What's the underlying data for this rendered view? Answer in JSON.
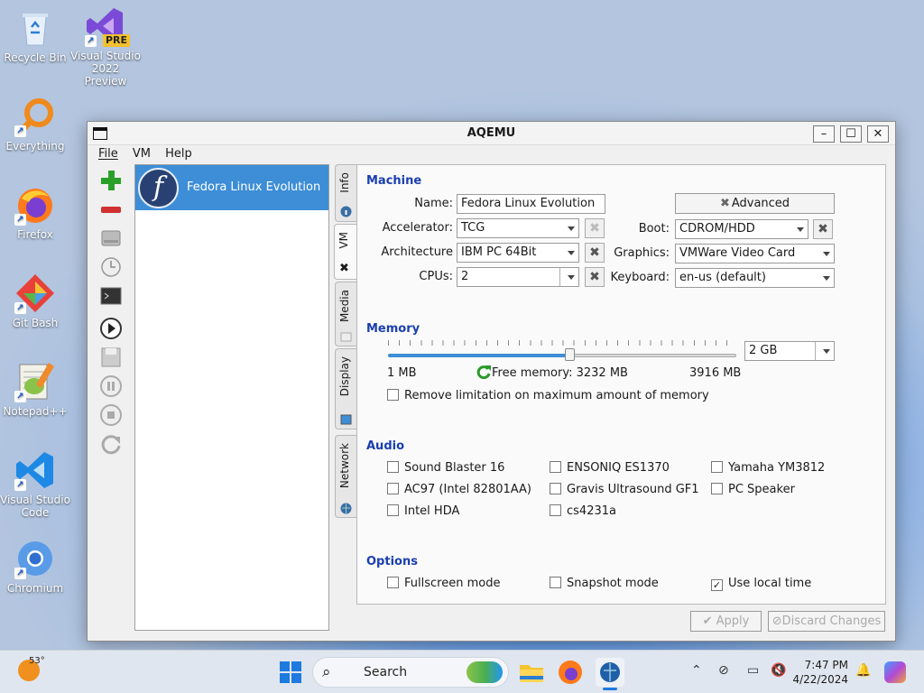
{
  "desktop": {
    "icons": [
      {
        "label": "Recycle Bin"
      },
      {
        "label": "Visual Studio 2022 Preview",
        "badge": "PRE"
      },
      {
        "label": "Everything"
      },
      {
        "label": "Firefox"
      },
      {
        "label": "Git Bash"
      },
      {
        "label": "Notepad++"
      },
      {
        "label": "Visual Studio Code"
      },
      {
        "label": "Chromium"
      }
    ]
  },
  "window": {
    "title": "AQEMU",
    "min": "–",
    "max": "☐",
    "close": "✕",
    "menu": [
      "File",
      "VM",
      "Help"
    ]
  },
  "vm_list": [
    {
      "name": "Fedora Linux Evolution",
      "logo": "f"
    }
  ],
  "tabs": [
    "Info",
    "VM",
    "Media",
    "Display",
    "Network"
  ],
  "machine": {
    "heading": "Machine",
    "name_label": "Name:",
    "name_value": "Fedora Linux Evolution",
    "accel_label": "Accelerator:",
    "accel_value": "TCG",
    "arch_label": "Architecture",
    "arch_value": "IBM PC 64Bit",
    "cpus_label": "CPUs:",
    "cpus_value": "2",
    "advanced_label": "Advanced",
    "boot_label": "Boot:",
    "boot_value": "CDROM/HDD",
    "graphics_label": "Graphics:",
    "graphics_value": "VMWare Video Card",
    "keyboard_label": "Keyboard:",
    "keyboard_value": "en-us (default)"
  },
  "memory": {
    "heading": "Memory",
    "value": "2 GB",
    "slider_fraction": 0.52,
    "min_label": "1 MB",
    "free_label": "Free memory: 3232 MB",
    "max_label": "3916 MB",
    "remove_limit": "Remove limitation on maximum amount of memory"
  },
  "audio": {
    "heading": "Audio",
    "cards": [
      "Sound Blaster 16",
      "ENSONIQ ES1370",
      "Yamaha YM3812",
      "AC97 (Intel 82801AA)",
      "Gravis Ultrasound GF1",
      "PC Speaker",
      "Intel HDA",
      "cs4231a"
    ]
  },
  "options": {
    "heading": "Options",
    "fullscreen": "Fullscreen mode",
    "snapshot": "Snapshot mode",
    "localtime": "Use local time",
    "localtime_checked": true
  },
  "buttons": {
    "apply": "Apply",
    "discard": "Discard Changes"
  },
  "taskbar": {
    "weather": "53°",
    "search": "Search",
    "time": "7:47 PM",
    "date": "4/22/2024"
  },
  "colors": {
    "accent": "#3d8ed6",
    "section": "#1a3fb0"
  }
}
